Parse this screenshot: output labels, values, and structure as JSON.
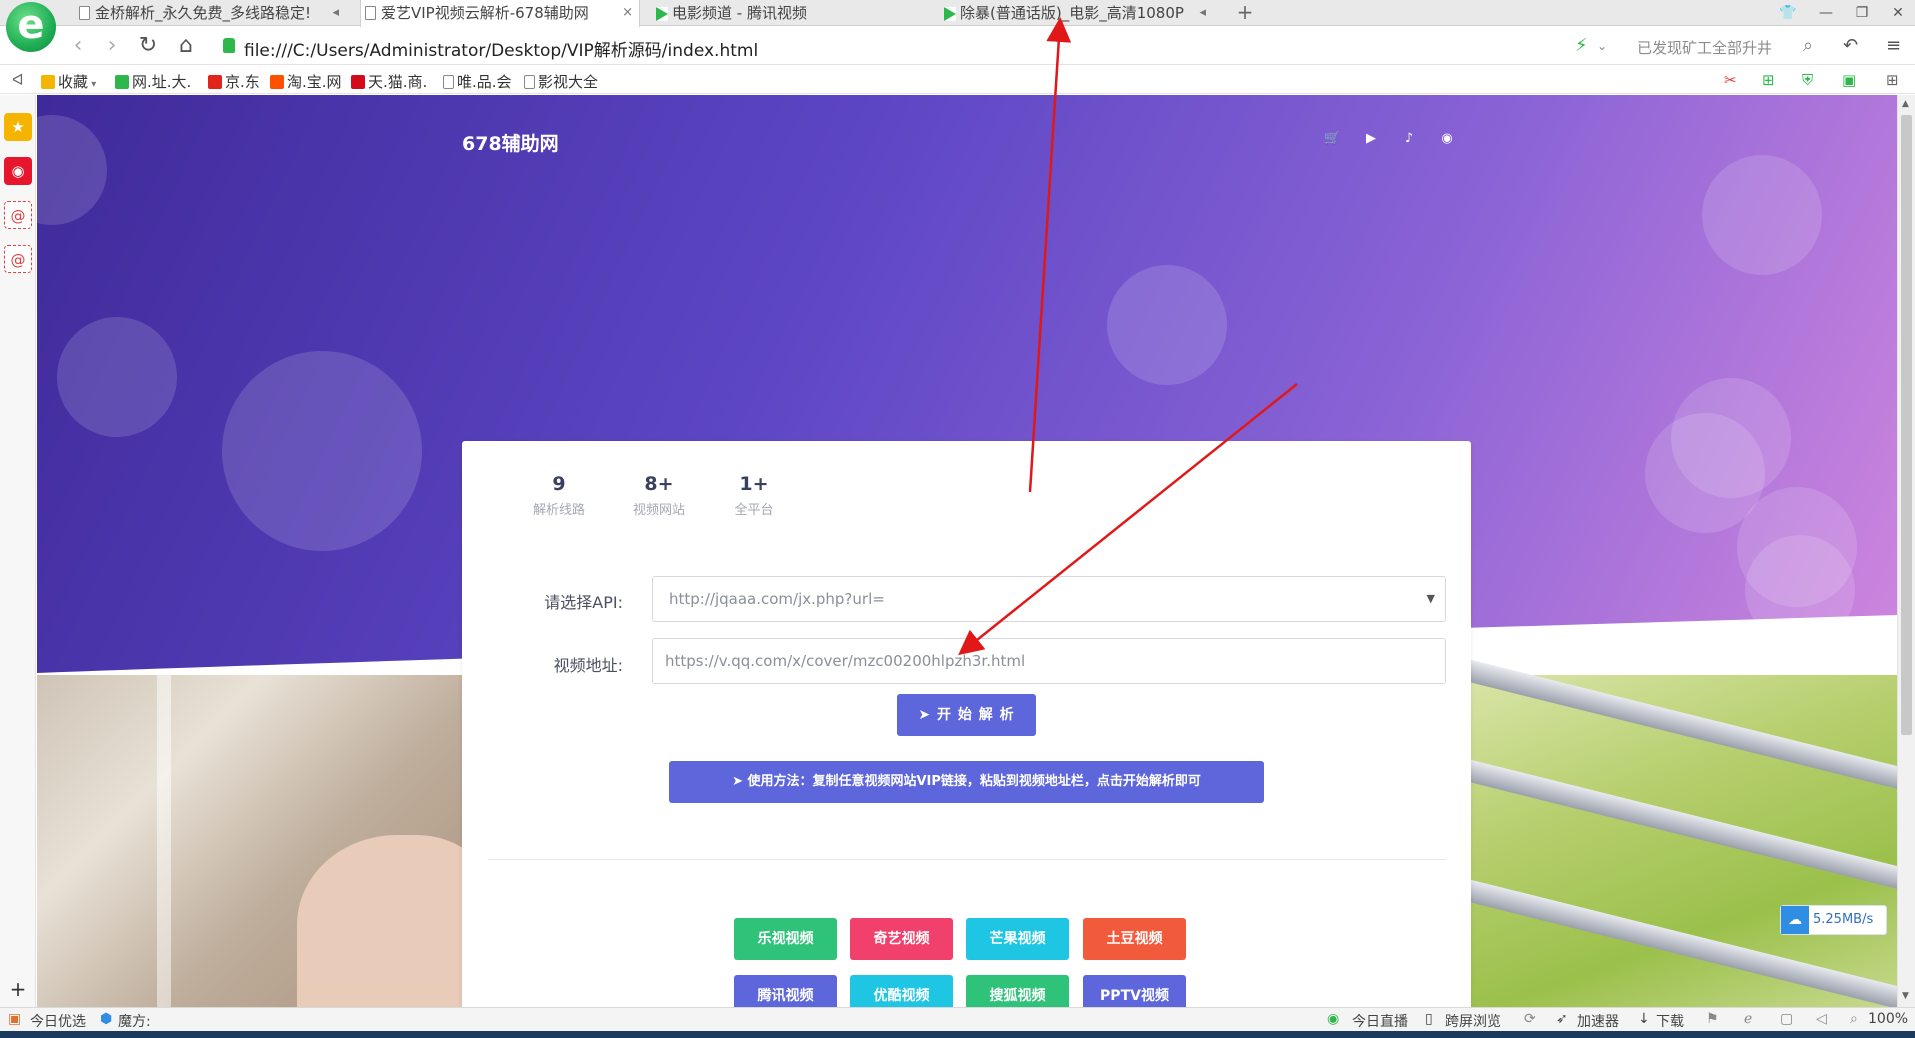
{
  "browser": {
    "logo": "e",
    "tabs": [
      {
        "title": "金桥解析_永久免费_多线路稳定!",
        "aux": "◂",
        "active": false
      },
      {
        "title": "爱艺VIP视频云解析-678辅助网",
        "aux": "×",
        "active": true
      },
      {
        "title": "电影频道 - 腾讯视频",
        "aux": "",
        "active": false
      },
      {
        "title": "除暴(普通话版)_电影_高清1080P",
        "aux": "◂",
        "active": false
      }
    ],
    "new_tab": "+",
    "url": "file:///C:/Users/Administrator/Desktop/VIP解析源码/index.html",
    "ad_text": "已发现矿工全部升井",
    "bookmarks": [
      {
        "label": "收藏",
        "icon_color": "#f5b400",
        "icon": "star-icon"
      },
      {
        "label": "网.址.大.",
        "icon_color": "#2eb84b",
        "icon": "check-icon"
      },
      {
        "label": "京.东",
        "icon_color": "#e1251b",
        "icon": "jd-icon"
      },
      {
        "label": "淘.宝.网",
        "icon_color": "#ff5000",
        "icon": "taobao-icon"
      },
      {
        "label": "天.猫.商.",
        "icon_color": "#d20a1c",
        "icon": "tmall-icon"
      },
      {
        "label": "唯.品.会",
        "icon_color": "#ffffff",
        "icon": "page-icon"
      },
      {
        "label": "影视大全",
        "icon_color": "#ffffff",
        "icon": "page-icon"
      }
    ]
  },
  "page": {
    "brand": "678辅助网",
    "stats": [
      {
        "num": "9",
        "label": "解析线路"
      },
      {
        "num": "8+",
        "label": "视频网站"
      },
      {
        "num": "1+",
        "label": "全平台"
      }
    ],
    "form": {
      "api_label": "请选择API:",
      "api_value": "http://jqaaa.com/jx.php?url=",
      "video_label": "视频地址:",
      "video_value": "https://v.qq.com/x/cover/mzc00200hlpzh3r.html"
    },
    "start_button": "开 始 解 析",
    "usage_button": "使用方法：复制任意视频网站VIP链接，粘贴到视频地址栏，点击开始解析即可",
    "sites": [
      {
        "label": "乐视视频",
        "color": "#2fc37a"
      },
      {
        "label": "奇艺视频",
        "color": "#f0406b"
      },
      {
        "label": "芒果视频",
        "color": "#1ec6e3"
      },
      {
        "label": "土豆视频",
        "color": "#f25a3c"
      },
      {
        "label": "腾讯视频",
        "color": "#5d66db"
      },
      {
        "label": "优酷视频",
        "color": "#1ec6e3"
      },
      {
        "label": "搜狐视频",
        "color": "#2fc37a"
      },
      {
        "label": "PPTV视频",
        "color": "#5d66db"
      }
    ],
    "speed": "5.25MB/s"
  },
  "statusbar": {
    "left": [
      "今日优选",
      "魔方:"
    ],
    "right": [
      "今日直播",
      "跨屏浏览",
      "加速器",
      "下载",
      "100%"
    ]
  }
}
